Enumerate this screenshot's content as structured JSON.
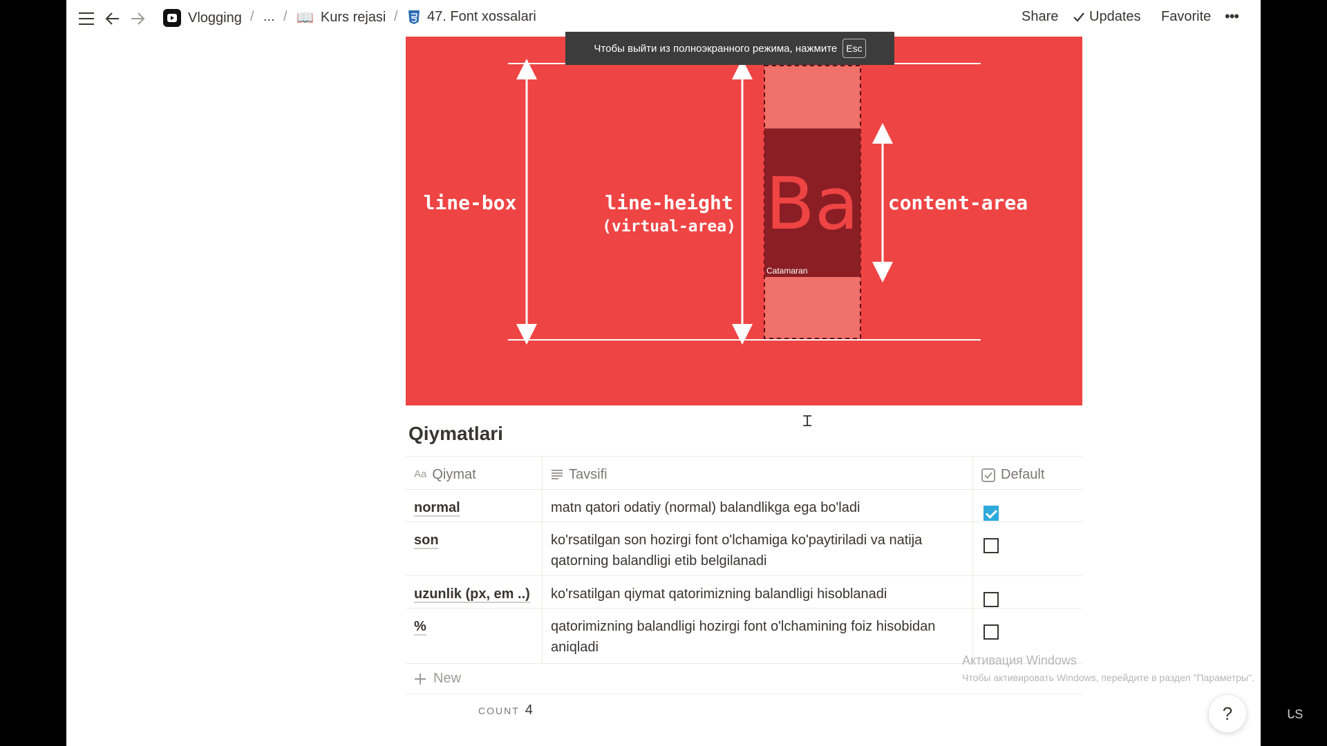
{
  "topbar": {
    "breadcrumbs": [
      "Vlogging",
      "...",
      "Kurs rejasi",
      "47. Font xossalari"
    ],
    "share": "Share",
    "updates": "Updates",
    "favorite": "Favorite",
    "more": "•••"
  },
  "fullscreen_notice": {
    "text": "Чтобы выйти из полноэкранного режима, нажмите",
    "key": "Esc"
  },
  "diagram": {
    "labels": {
      "line_box": "line-box",
      "line_height": "line-height",
      "virtual_area": "(virtual-area)",
      "content_area": "content-area",
      "glyph": "Ba",
      "font_name": "Catamaran"
    },
    "colors": {
      "background": "#ef4444",
      "content_box": "#8b1e24",
      "virtual_box": "#f0706a"
    }
  },
  "section": {
    "title": "Qiymatlari"
  },
  "table": {
    "headers": [
      "Qiymat",
      "Tavsifi",
      "Default"
    ],
    "rows": [
      {
        "value": "normal",
        "description": "matn qatori odatiy (normal) balandlikga ega bo'ladi",
        "default": true
      },
      {
        "value": "son",
        "description": "ko'rsatilgan son hozirgi font o'lchamiga ko'paytiriladi va natija qatorning balandligi etib belgilanadi",
        "default": false
      },
      {
        "value": "uzunlik (px, em ..)",
        "description": "ko'rsatilgan qiymat qatorimizning balandligi hisoblanadi",
        "default": false
      },
      {
        "value": "%",
        "description": "qatorimizning balandligi hozirgi font o'lchamining foiz hisobidan aniqladi",
        "default": false
      }
    ],
    "new_label": "New",
    "count_label": "COUNT",
    "count_value": "4"
  },
  "watermark": {
    "title": "Активация Windows",
    "subtitle": "Чтобы активировать Windows, перейдите в раздел \"Параметры\"."
  },
  "help": "?",
  "corner_badge": "ᒐS"
}
